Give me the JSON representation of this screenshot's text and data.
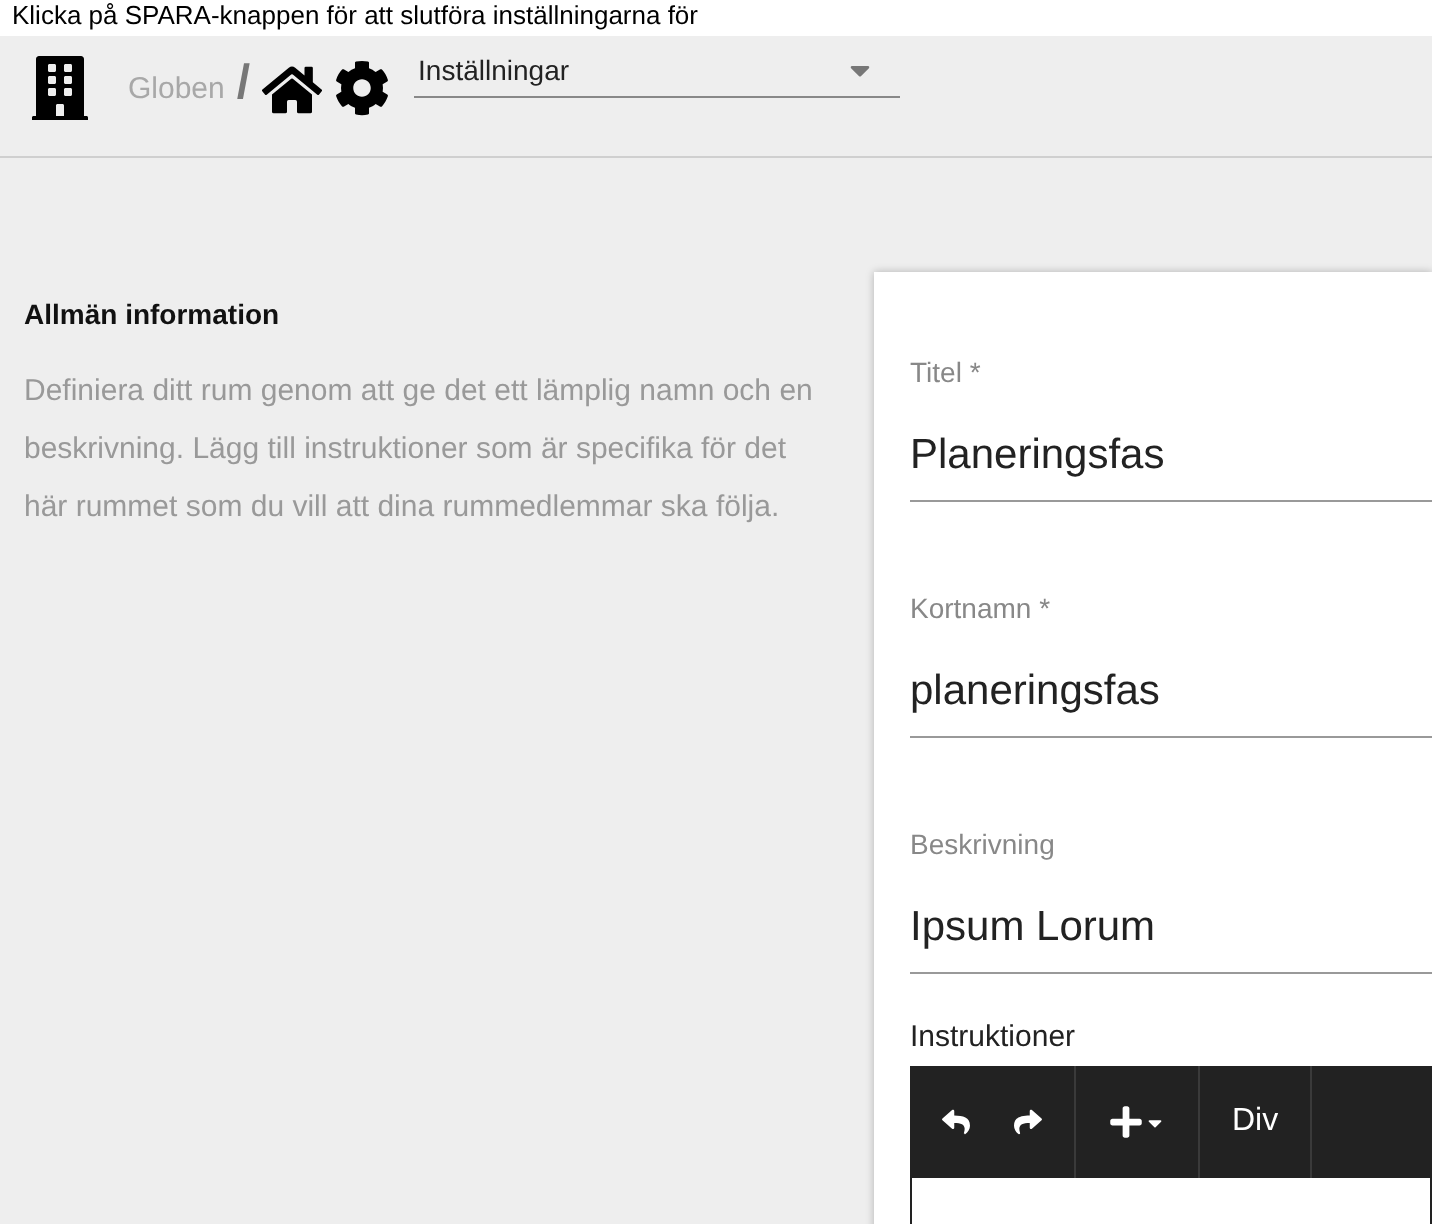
{
  "caption": "Klicka på SPARA-knappen för att slutföra inställningarna för",
  "breadcrumb": {
    "parent": "Globen",
    "separator": "/",
    "select": {
      "value": "Inställningar"
    }
  },
  "section": {
    "title": "Allmän information",
    "description": "Definiera ditt rum genom att ge det ett lämplig namn och en beskrivning. Lägg till instruktioner som är specifika för det här rummet som du vill att dina rummedlemmar ska följa."
  },
  "fields": [
    {
      "label": "Titel *",
      "value": "Planeringsfas"
    },
    {
      "label": "Kortnamn *",
      "value": "planeringsfas"
    },
    {
      "label": "Beskrivning",
      "value": "Ipsum Lorum"
    }
  ],
  "editor": {
    "label": "Instruktioner",
    "toolbar": [
      {
        "kind": "undo"
      },
      {
        "kind": "redo"
      },
      {
        "kind": "insert"
      },
      {
        "kind": "text",
        "label": "Div"
      }
    ]
  }
}
